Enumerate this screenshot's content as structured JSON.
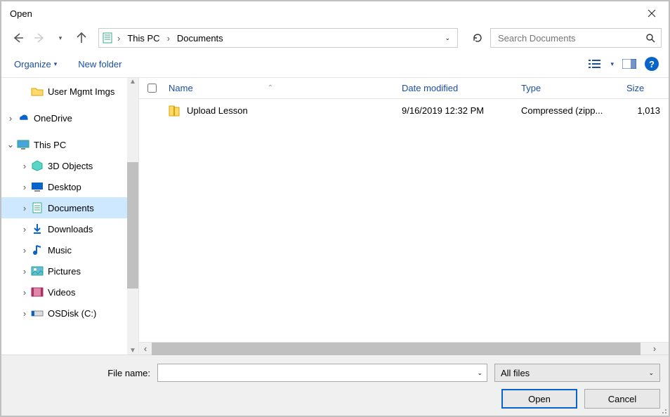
{
  "window": {
    "title": "Open"
  },
  "breadcrumb": {
    "loc1": "This PC",
    "loc2": "Documents"
  },
  "search": {
    "placeholder": "Search Documents"
  },
  "toolbar": {
    "organize": "Organize",
    "new_folder": "New folder"
  },
  "tree": {
    "user_mgmt": "User Mgmt Imgs",
    "onedrive": "OneDrive",
    "this_pc": "This PC",
    "objects3d": "3D Objects",
    "desktop": "Desktop",
    "documents": "Documents",
    "downloads": "Downloads",
    "music": "Music",
    "pictures": "Pictures",
    "videos": "Videos",
    "osdisk": "OSDisk (C:)"
  },
  "cols": {
    "name": "Name",
    "date": "Date modified",
    "type": "Type",
    "size": "Size"
  },
  "files": [
    {
      "name": "Upload Lesson",
      "date": "9/16/2019 12:32 PM",
      "type": "Compressed (zipp...",
      "size": "1,013"
    }
  ],
  "footer": {
    "filename_label": "File name:",
    "filename_value": "",
    "filter": "All files",
    "open": "Open",
    "cancel": "Cancel"
  }
}
